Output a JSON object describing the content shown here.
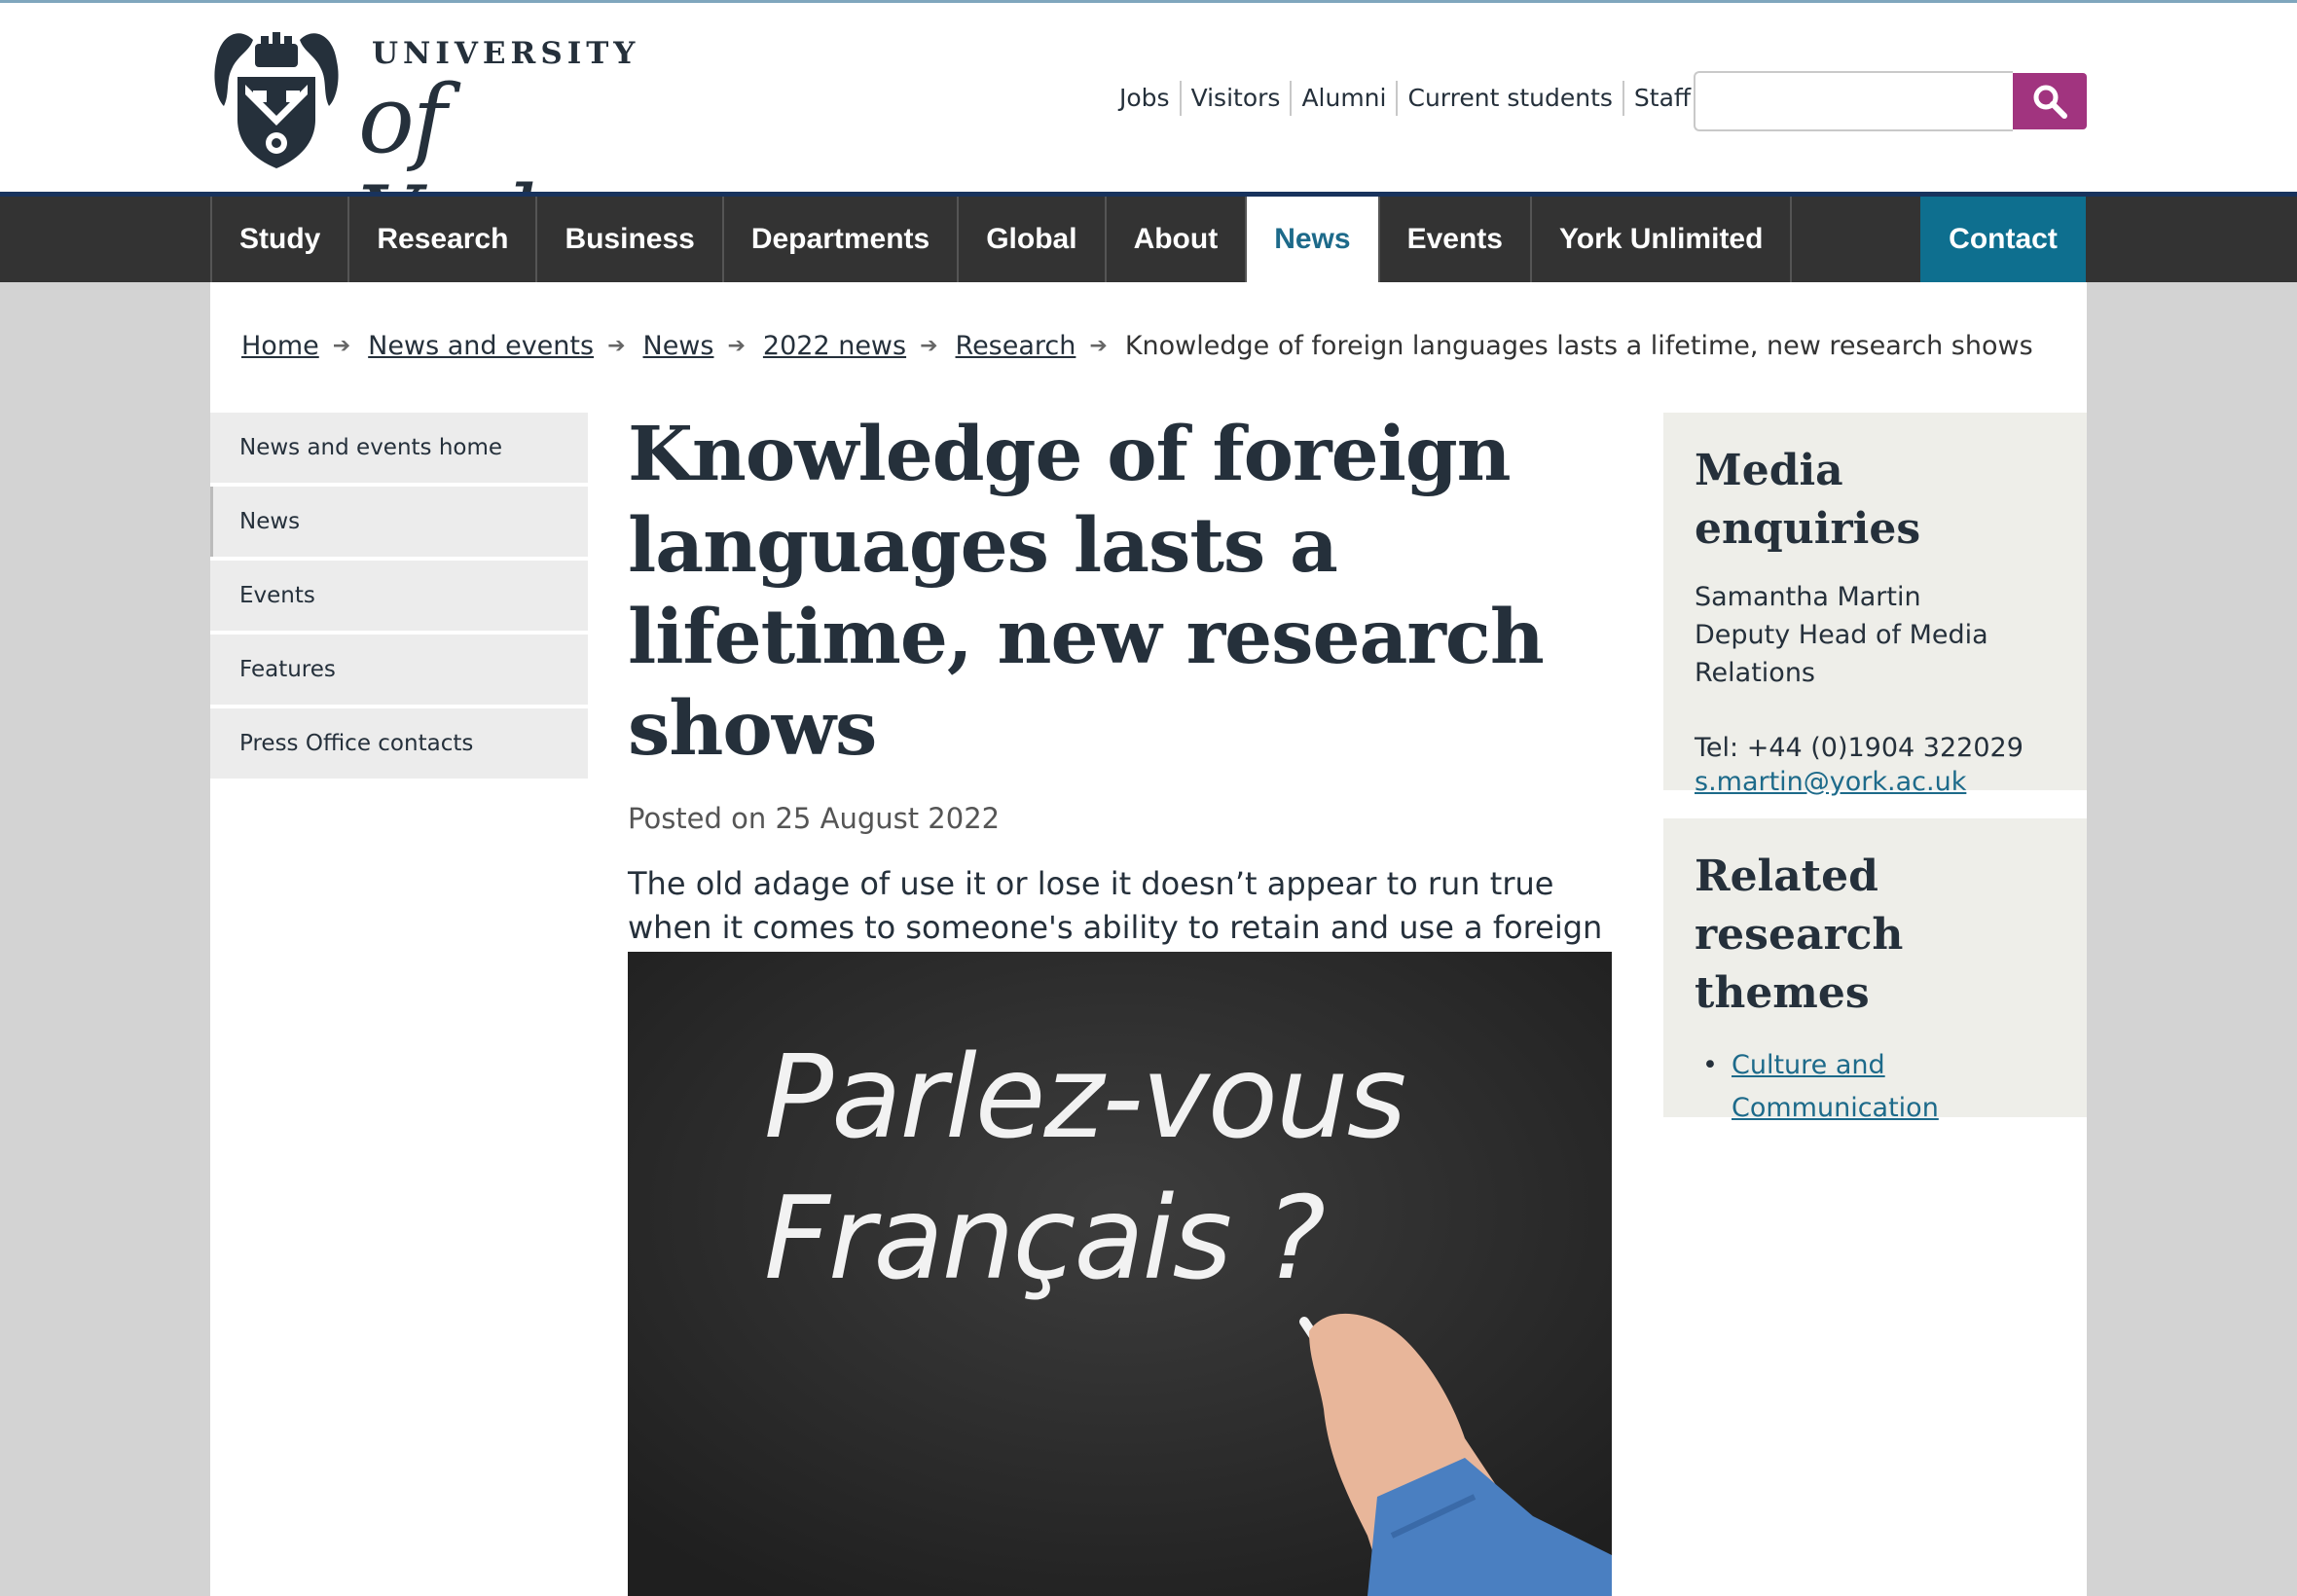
{
  "header": {
    "logo": {
      "line1": "UNIVERSITY",
      "line2": "of York"
    },
    "utility_links": [
      "Jobs",
      "Visitors",
      "Alumni",
      "Current students",
      "Staff"
    ],
    "search": {
      "placeholder": ""
    }
  },
  "nav": {
    "items": [
      "Study",
      "Research",
      "Business",
      "Departments",
      "Global",
      "About",
      "News",
      "Events",
      "York Unlimited"
    ],
    "active": "News",
    "contact": "Contact"
  },
  "breadcrumb": {
    "links": [
      "Home",
      "News and events",
      "News",
      "2022 news",
      "Research"
    ],
    "current": "Knowledge of foreign languages lasts a lifetime, new research shows"
  },
  "sidenav": {
    "items": [
      "News and events home",
      "News",
      "Events",
      "Features",
      "Press Office contacts"
    ]
  },
  "article": {
    "title": "Knowledge of foreign languages lasts a lifetime, new research shows",
    "posted": "Posted on 25 August 2022",
    "lead": "The old adage of use it or lose it doesn’t appear to run true when it comes to someone's ability to retain and use a foreign language, a new study has revealed.",
    "image_text": {
      "line1": "Parlez-vous",
      "line2": "Français ?"
    }
  },
  "media": {
    "heading": "Media enquiries",
    "name": "Samantha Martin",
    "role_line1": "Deputy Head of Media",
    "role_line2": "Relations",
    "tel": "Tel: +44 (0)1904 322029",
    "email": "s.martin@york.ac.uk"
  },
  "related": {
    "heading_line1": "Related research",
    "heading_line2": "themes",
    "items": [
      "Culture and Communication"
    ]
  },
  "colors": {
    "nav_bg": "#333333",
    "nav_active_text": "#1d6a8a",
    "contact_bg": "#0e6f8f",
    "search_button": "#a1347f",
    "link": "#1d6a8a",
    "aside_bg": "#eeeee9"
  },
  "icons": {
    "search_button": "search-icon",
    "breadcrumb_separator": "arrow-right-icon",
    "crest": "crest-icon"
  }
}
